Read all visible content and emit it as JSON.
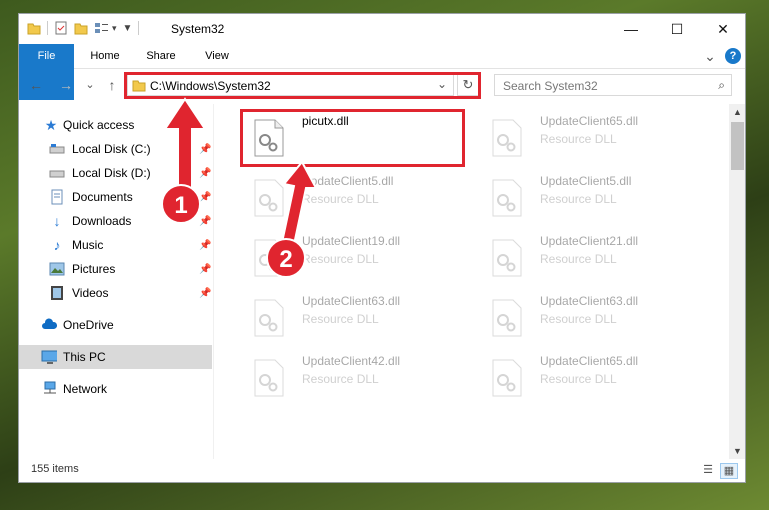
{
  "window": {
    "title": "System32",
    "controls": {
      "minimize": "—",
      "maximize": "☐",
      "close": "✕"
    }
  },
  "ribbon": {
    "tabs": [
      {
        "label": "File"
      },
      {
        "label": "Home"
      },
      {
        "label": "Share"
      },
      {
        "label": "View"
      }
    ],
    "expand": "⌄",
    "help": "?"
  },
  "nav": {
    "back": "←",
    "forward": "→",
    "recent": "⌄",
    "up": "↑",
    "address_path": "C:\\Windows\\System32",
    "address_dropdown": "⌄",
    "refresh": "↻",
    "search_placeholder": "Search System32"
  },
  "sidebar": {
    "items": [
      {
        "label": "Quick access",
        "icon": "star-icon"
      },
      {
        "label": "Local Disk (C:)",
        "icon": "drive-icon",
        "pinned": true
      },
      {
        "label": "Local Disk (D:)",
        "icon": "drive-icon",
        "pinned": true
      },
      {
        "label": "Documents",
        "icon": "documents-icon",
        "pinned": true
      },
      {
        "label": "Downloads",
        "icon": "downloads-icon",
        "pinned": true
      },
      {
        "label": "Music",
        "icon": "music-icon",
        "pinned": true
      },
      {
        "label": "Pictures",
        "icon": "pictures-icon",
        "pinned": true
      },
      {
        "label": "Videos",
        "icon": "videos-icon",
        "pinned": true
      },
      {
        "label": "OneDrive",
        "icon": "cloud-icon"
      },
      {
        "label": "This PC",
        "icon": "computer-icon",
        "selected": true
      },
      {
        "label": "Network",
        "icon": "network-icon"
      }
    ]
  },
  "files": [
    {
      "name": "picutx.dll",
      "type": ""
    },
    {
      "name": "UpdateClient65.dll",
      "type": "Resource DLL"
    },
    {
      "name": "UpdateClient5.dll",
      "type": "Resource DLL"
    },
    {
      "name": "UpdateClient5.dll",
      "type": "Resource DLL"
    },
    {
      "name": "UpdateClient19.dll",
      "type": "Resource DLL"
    },
    {
      "name": "UpdateClient21.dll",
      "type": "Resource DLL"
    },
    {
      "name": "UpdateClient63.dll",
      "type": "Resource DLL"
    },
    {
      "name": "UpdateClient63.dll",
      "type": "Resource DLL"
    },
    {
      "name": "UpdateClient42.dll",
      "type": "Resource DLL"
    },
    {
      "name": "UpdateClient65.dll",
      "type": "Resource DLL"
    }
  ],
  "status": {
    "item_count": "155 items"
  },
  "annotations": {
    "step1": "1",
    "step2": "2"
  },
  "colors": {
    "accent": "#1979ca",
    "highlight": "#e0252f"
  }
}
